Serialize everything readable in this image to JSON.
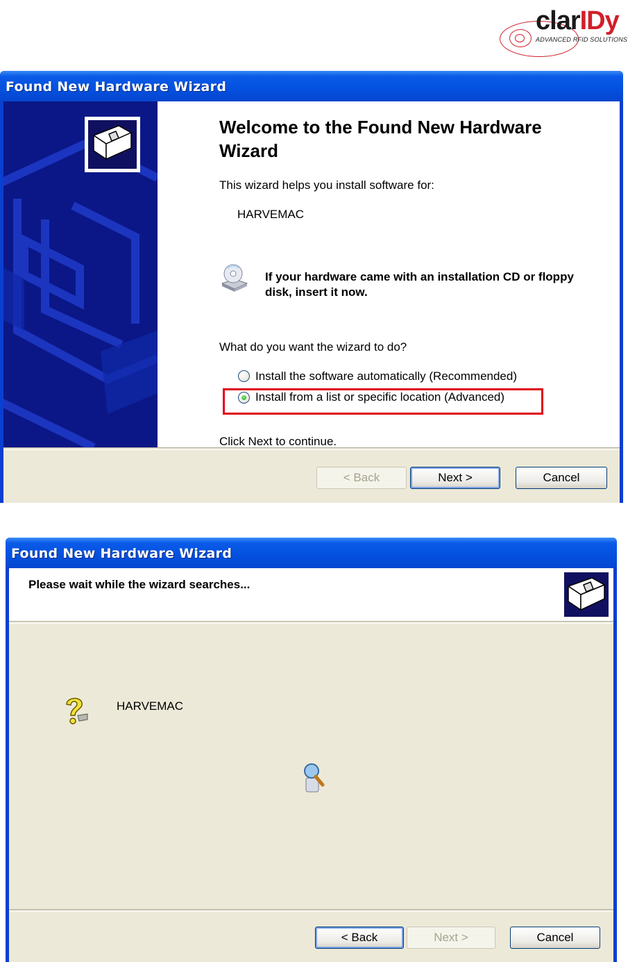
{
  "logo": {
    "word_a": "clar",
    "word_b": "IDy",
    "tagline": "ADVANCED RFID SOLUTIONS"
  },
  "window1": {
    "title": "Found New Hardware Wizard",
    "heading": "Welcome to the Found New Hardware Wizard",
    "intro": "This wizard helps you install software for:",
    "device": "HARVEMAC",
    "cd_message": "If your hardware came with an installation CD or floppy disk, insert it now.",
    "question": "What do you want the wizard to do?",
    "options": [
      {
        "label": "Install the software automatically (Recommended)",
        "selected": false
      },
      {
        "label": "Install from a list or specific location (Advanced)",
        "selected": true
      }
    ],
    "continue_text": "Click Next to continue.",
    "buttons": {
      "back": "< Back",
      "next": "Next >",
      "cancel": "Cancel"
    }
  },
  "window2": {
    "title": "Found New Hardware Wizard",
    "header_text": "Please wait while the wizard searches...",
    "device": "HARVEMAC",
    "buttons": {
      "back": "< Back",
      "next": "Next >",
      "cancel": "Cancel"
    }
  },
  "colors": {
    "titlebar": "#0450de",
    "highlight_box": "#e00012",
    "sidebar": "#0a1a86"
  },
  "icons": [
    "hardware-wizard-icon",
    "cd-drive-icon",
    "question-mark-icon",
    "search-icon"
  ]
}
